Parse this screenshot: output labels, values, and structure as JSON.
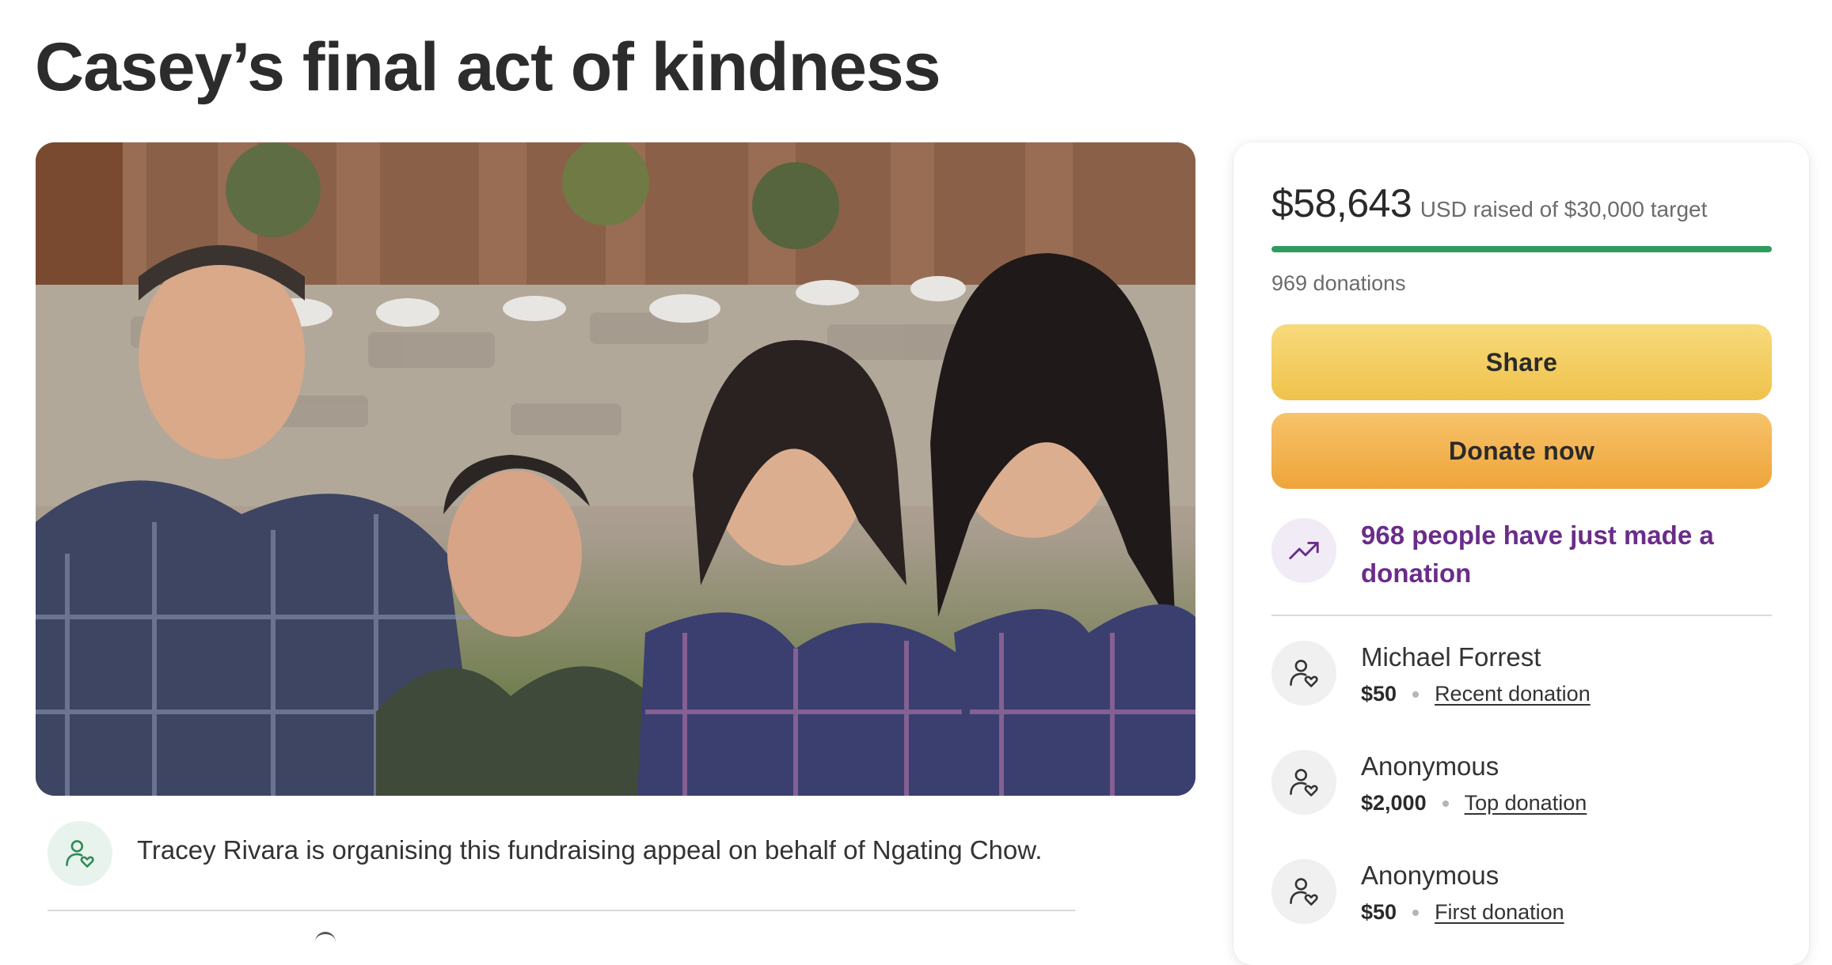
{
  "page": {
    "title": "Casey’s final act of kindness",
    "organiser_text": "Tracey Rivara is organising this fundraising appeal on behalf of Ngating Chow."
  },
  "hero_image": {
    "description_icon": "family-photo"
  },
  "fundraiser": {
    "amount_raised": "$58,643",
    "raised_label": "USD raised of $30,000 target",
    "progress_fraction": 1.0,
    "donations_count": "969 donations",
    "share_label": "Share",
    "donate_label": "Donate now",
    "trend_text": "968 people have just made a donation"
  },
  "donors": [
    {
      "name": "Michael Forrest",
      "amount": "$50",
      "type": "Recent donation"
    },
    {
      "name": "Anonymous",
      "amount": "$2,000",
      "type": "Top donation"
    },
    {
      "name": "Anonymous",
      "amount": "$50",
      "type": "First donation"
    }
  ],
  "colors": {
    "progress": "#2f9b5e",
    "share_button": "#f0c24c",
    "donate_button": "#efa43a",
    "trend_text": "#6a2c8a",
    "organiser_icon_bg": "#e7f3ec"
  },
  "icons": {
    "organiser": "user-heart-icon",
    "trend": "trending-up-icon",
    "donor": "user-heart-icon"
  }
}
